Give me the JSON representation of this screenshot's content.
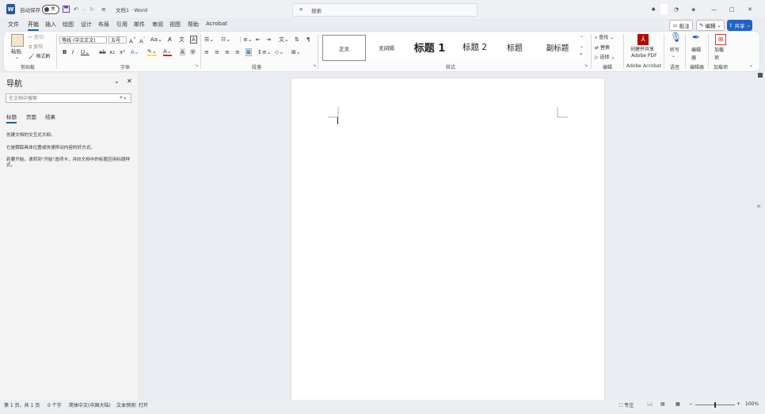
{
  "titlebar": {
    "autosave_label": "自动保存",
    "autosave_state": "关",
    "doc_title": "文档1 · Word",
    "search_placeholder": "搜索"
  },
  "tabs": [
    "文件",
    "开始",
    "插入",
    "绘图",
    "设计",
    "布局",
    "引用",
    "邮件",
    "审阅",
    "视图",
    "帮助",
    "Acrobat"
  ],
  "tab_active": "开始",
  "top_right": {
    "comment": "批注",
    "edit": "编辑",
    "share": "共享"
  },
  "ribbon": {
    "clipboard": {
      "paste": "粘贴",
      "cut": "剪切",
      "copy": "复制",
      "format_painter": "格式刷",
      "label": "剪贴板"
    },
    "font": {
      "font_name": "等线 (中文正文)",
      "font_size": "五号",
      "label": "字体"
    },
    "paragraph": {
      "label": "段落"
    },
    "styles": {
      "items": [
        "正文",
        "无间隔",
        "标题 1",
        "标题 2",
        "标题",
        "副标题"
      ],
      "label": "样式"
    },
    "editing": {
      "find": "查找",
      "replace": "替换",
      "select": "选择",
      "label": "编辑"
    },
    "acrobat": {
      "create": "创建并共享",
      "create2": "Adobe PDF",
      "label": "Adobe Acrobat"
    },
    "voice": {
      "dictate": "听写",
      "label": "语音"
    },
    "editor": {
      "editor": "编辑器",
      "label": "编辑器"
    },
    "addins": {
      "addins": "加载项",
      "label": "加载项"
    }
  },
  "nav": {
    "title": "导航",
    "search_placeholder": "在文档中搜索",
    "tabs": [
      "标题",
      "页面",
      "结果"
    ],
    "text1": "创建文档的交互式大纲。",
    "text2": "它是跟踪具体位置或快速移动内容的好方式。",
    "text3": "若要开始，请转到\"开始\"选项卡，并向文档中的标题应用标题样式。"
  },
  "status": {
    "page": "第 1 页，共 1 页",
    "words": "0 个字",
    "lang": "简体中文(中国大陆)",
    "predict": "文本预测: 打开",
    "focus": "专注",
    "zoom": "100%"
  },
  "colors": {
    "accent": "#2b579a",
    "share": "#1f63c4"
  }
}
